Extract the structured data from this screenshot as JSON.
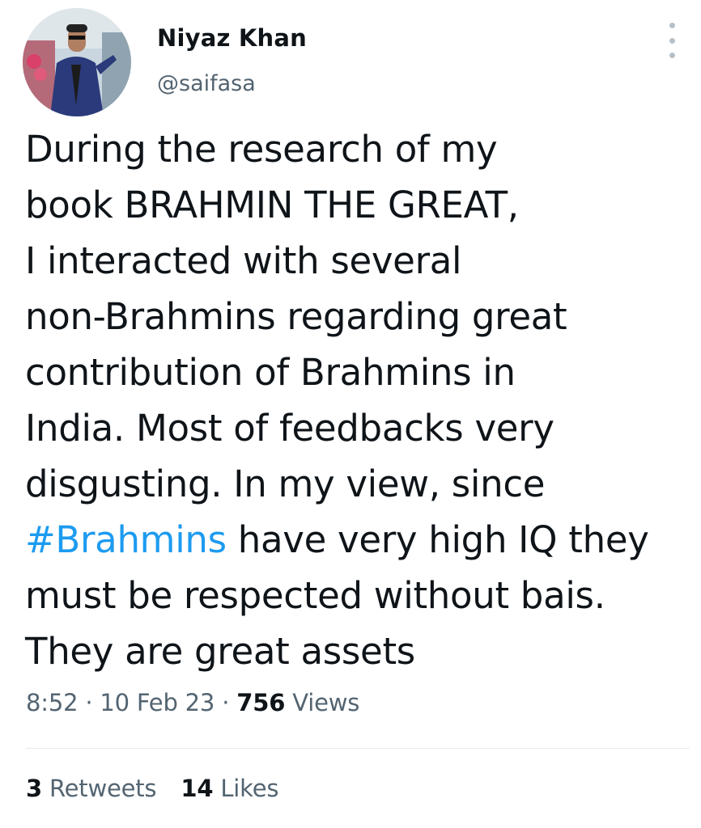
{
  "author": {
    "name": "Niyaz Khan",
    "handle": "@saifasa"
  },
  "tweet": {
    "text_lines": [
      "During the research of my",
      "book BRAHMIN THE GREAT,",
      "I interacted with several",
      "non-Brahmins regarding great",
      "contribution of Brahmins in",
      "India. Most of feedbacks very",
      "disgusting. In my view, since"
    ],
    "hashtag": "#Brahmins",
    "after_hashtag": " have very high IQ they",
    "text_lines_end": [
      "must be respected without bais.",
      "They are great assets"
    ]
  },
  "meta": {
    "time": "8:52",
    "separator": " · ",
    "date": "10 Feb 23",
    "views_count": "756",
    "views_label": " Views"
  },
  "stats": {
    "retweets_count": "3",
    "retweets_label": " Retweets",
    "likes_count": "14",
    "likes_label": " Likes"
  },
  "colors": {
    "hashtag": "#1d9bf0",
    "secondary_text": "#536471",
    "primary_text": "#0f1419"
  },
  "icons": {
    "more": "more-vertical-icon"
  }
}
